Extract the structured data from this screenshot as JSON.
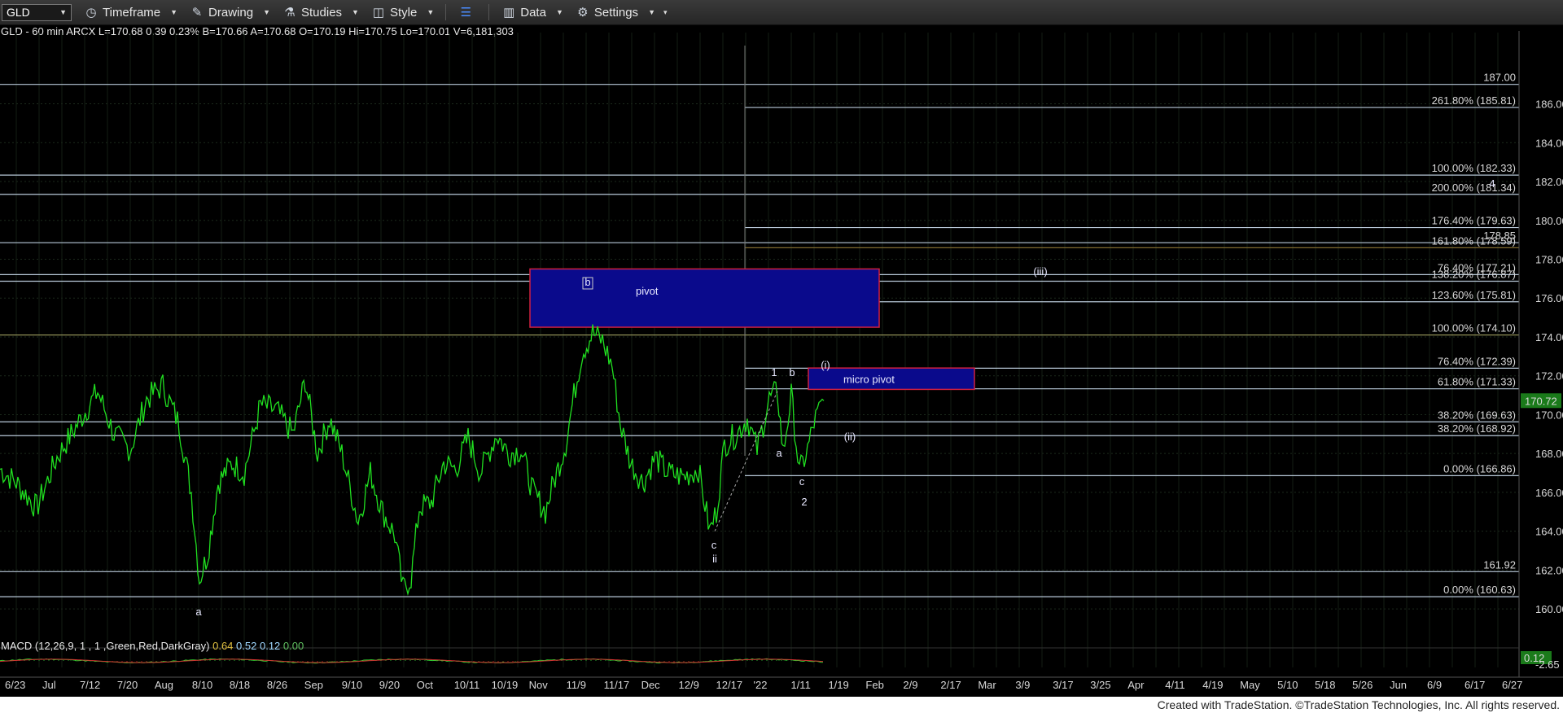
{
  "toolbar": {
    "symbol": "GLD",
    "timeframe": "Timeframe",
    "drawing": "Drawing",
    "studies": "Studies",
    "style": "Style",
    "data": "Data",
    "settings": "Settings"
  },
  "info_line": "GLD - 60 min  ARCX  L=170.68  0.39  0.23%  B=170.66  A=170.68  O=170.19  Hi=170.75  Lo=170.01  V=6,181,303",
  "macd": {
    "label": "MACD (12,26,9, 1 , 1 ,Green,Red,DarkGray)",
    "v1": "0.64",
    "v2": "0.52",
    "v3": "0.12",
    "v4": "0.00",
    "axis_top": "0.12",
    "axis_bottom": "-2.65"
  },
  "footer": "Created with TradeStation. ©TradeStation Technologies, Inc. All rights reserved.",
  "colors": {
    "price": "#20e020",
    "pivot_fill": "#0a0a8c",
    "pivot_border": "#d02040",
    "fib_line": "#b8c8d8",
    "grid": "#1c2a1c",
    "last_price_bg": "#1a7a1a"
  },
  "chart_data": {
    "type": "line",
    "ylim": [
      159.0,
      189.5
    ],
    "price_ticks": [
      "186.00",
      "184.00",
      "182.00",
      "180.00",
      "178.00",
      "176.00",
      "174.00",
      "172.00",
      "170.00",
      "168.00",
      "166.00",
      "164.00",
      "162.00",
      "160.00"
    ],
    "last_price": "170.72",
    "x_ticks": [
      "6/23",
      "Jul",
      "7/12",
      "7/20",
      "Aug",
      "8/10",
      "8/18",
      "8/26",
      "Sep",
      "9/10",
      "9/20",
      "Oct",
      "10/11",
      "10/19",
      "Nov",
      "11/9",
      "11/17",
      "Dec",
      "12/9",
      "12/17",
      "'22",
      "1/11",
      "1/19",
      "Feb",
      "2/9",
      "2/17",
      "Mar",
      "3/9",
      "3/17",
      "3/25",
      "Apr",
      "4/11",
      "4/19",
      "May",
      "5/10",
      "5/18",
      "5/26",
      "Jun",
      "6/9",
      "6/17",
      "6/27"
    ],
    "price_series": [
      [
        0,
        167.2
      ],
      [
        20,
        166.5
      ],
      [
        45,
        165.2
      ],
      [
        70,
        167.8
      ],
      [
        95,
        169.5
      ],
      [
        120,
        171.2
      ],
      [
        140,
        169.0
      ],
      [
        160,
        168.2
      ],
      [
        180,
        170.8
      ],
      [
        200,
        171.5
      ],
      [
        220,
        169.5
      ],
      [
        235,
        166.0
      ],
      [
        245,
        161.5
      ],
      [
        255,
        162.8
      ],
      [
        268,
        166.5
      ],
      [
        285,
        167.5
      ],
      [
        300,
        167.0
      ],
      [
        320,
        170.5
      ],
      [
        340,
        170.2
      ],
      [
        360,
        169.0
      ],
      [
        375,
        171.8
      ],
      [
        390,
        168.0
      ],
      [
        405,
        169.8
      ],
      [
        420,
        168.0
      ],
      [
        440,
        164.5
      ],
      [
        455,
        167.0
      ],
      [
        470,
        165.0
      ],
      [
        485,
        163.8
      ],
      [
        495,
        161.0
      ],
      [
        505,
        161.6
      ],
      [
        515,
        165.2
      ],
      [
        530,
        165.5
      ],
      [
        545,
        167.5
      ],
      [
        560,
        167.2
      ],
      [
        575,
        168.8
      ],
      [
        590,
        167.0
      ],
      [
        610,
        169.0
      ],
      [
        625,
        168.0
      ],
      [
        640,
        168.2
      ],
      [
        655,
        166.0
      ],
      [
        670,
        165.0
      ],
      [
        680,
        166.5
      ],
      [
        695,
        168.5
      ],
      [
        705,
        171.0
      ],
      [
        715,
        173.2
      ],
      [
        728,
        174.2
      ],
      [
        740,
        173.8
      ],
      [
        752,
        172.5
      ],
      [
        762,
        169.5
      ],
      [
        775,
        167.5
      ],
      [
        790,
        166.5
      ],
      [
        805,
        167.8
      ],
      [
        820,
        167.0
      ],
      [
        840,
        166.8
      ],
      [
        858,
        167.2
      ],
      [
        872,
        164.0
      ],
      [
        880,
        165.0
      ],
      [
        890,
        168.5
      ],
      [
        905,
        169.0
      ],
      [
        918,
        169.8
      ],
      [
        930,
        168.2
      ],
      [
        945,
        170.8
      ],
      [
        955,
        171.2
      ],
      [
        962,
        168.0
      ],
      [
        972,
        171.0
      ],
      [
        982,
        167.0
      ],
      [
        992,
        168.2
      ],
      [
        1000,
        169.6
      ],
      [
        1012,
        170.72
      ]
    ],
    "fib_levels": [
      {
        "label": "261.80% (185.81)",
        "price": 185.81
      },
      {
        "label": "100.00% (182.33)",
        "price": 182.33
      },
      {
        "label": "200.00% (181.34)",
        "price": 181.34
      },
      {
        "label": "176.40% (179.63)",
        "price": 179.63
      },
      {
        "label": "178.85",
        "price": 178.85
      },
      {
        "label": "161.80% (178.59)",
        "price": 178.59
      },
      {
        "label": "76.40% (177.21)",
        "price": 177.21
      },
      {
        "label": "138.20% (176.87)",
        "price": 176.87
      },
      {
        "label": "123.60% (175.81)",
        "price": 175.81
      },
      {
        "label": "100.00% (174.10)",
        "price": 174.1
      },
      {
        "label": "76.40% (172.39)",
        "price": 172.39
      },
      {
        "label": "61.80% (171.33)",
        "price": 171.33
      },
      {
        "label": "38.20% (169.63)",
        "price": 169.63
      },
      {
        "label": "38.20% (168.92)",
        "price": 168.92
      },
      {
        "label": "0.00% (166.86)",
        "price": 166.86
      },
      {
        "label": "161.92",
        "price": 161.92
      },
      {
        "label": "0.00% (160.63)",
        "price": 160.63
      },
      {
        "label": "187.00",
        "price": 187.0
      }
    ],
    "zones": [
      {
        "label": "pivot",
        "top": 177.5,
        "bottom": 174.5
      },
      {
        "label": "micro pivot",
        "top": 172.4,
        "bottom": 171.3
      }
    ],
    "annotations": [
      "b",
      "a",
      "c",
      "ii",
      "1",
      "b",
      "a",
      "c",
      "2",
      "(i)",
      "(ii)",
      "(iii)",
      "4"
    ],
    "macd_series": []
  }
}
